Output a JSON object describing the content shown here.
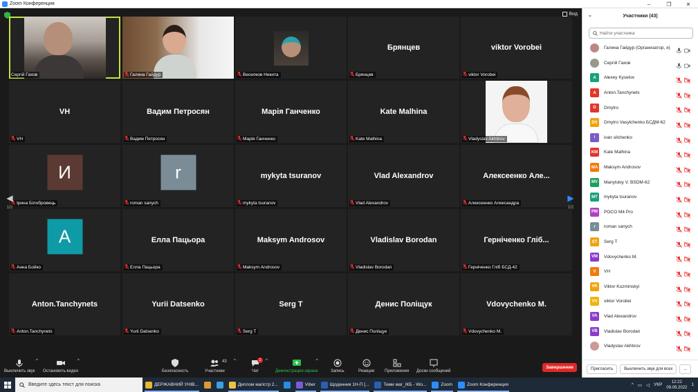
{
  "window": {
    "title": "Zoom Конференция",
    "controls": [
      "–",
      "❐",
      "✕"
    ]
  },
  "meeting": {
    "view_label": "Вид",
    "active_color": "#c5e543",
    "page_left": "1/2",
    "page_right": "1/2",
    "tiles": [
      {
        "name": "Сергій Гахов",
        "type": "video",
        "active": true
      },
      {
        "name": "Галина Гайдур",
        "type": "video"
      },
      {
        "name": "Веселков Никита",
        "type": "video"
      },
      {
        "big": "Брянцев",
        "name": "Брянцев"
      },
      {
        "big": "viktor Vorobei",
        "name": "viktor Vorobei"
      },
      {
        "big": "VH",
        "name": "VH"
      },
      {
        "big": "Вадим Петросян",
        "name": "Вадим Петросян"
      },
      {
        "big": "Марія Ганченко",
        "name": "Марія Ганченко"
      },
      {
        "big": "Kate Malhina",
        "name": "Kate Malhina"
      },
      {
        "name": "Vladyslav Akhtirov",
        "type": "photo"
      },
      {
        "avatar": "И",
        "avatar_color": "#5a3a32",
        "name": "Ірина Білобровець"
      },
      {
        "avatar": "r",
        "avatar_color": "#7a8d96",
        "name": "roman sanych"
      },
      {
        "big": "mykyta tsuranov",
        "name": "mykyta tsuranov"
      },
      {
        "big": "Vlad Alexandrov",
        "name": "Vlad Alexandrov"
      },
      {
        "big": "Алексеенко Але...",
        "name": "Алексеенко Александра"
      },
      {
        "avatar": "A",
        "avatar_color": "#0f9aa8",
        "name": "Анна Бойко"
      },
      {
        "big": "Елла Пацьора",
        "name": "Елла Пацьора"
      },
      {
        "big": "Maksym Androsov",
        "name": "Maksym Androsov"
      },
      {
        "big": "Vladislav Borodan",
        "name": "Vladislav Borodan"
      },
      {
        "big": "Герніченко Гліб...",
        "name": "Герніченко Гліб БСД-42"
      },
      {
        "big": "Anton.Tanchynets",
        "name": "Anton.Tanchynets"
      },
      {
        "big": "Yurii Datsenko",
        "name": "Yurii Datsenko"
      },
      {
        "big": "Serg T",
        "name": "Serg T"
      },
      {
        "big": "Денис Поліщук",
        "name": "Денис Поліщук"
      },
      {
        "big": "Vdovychenko M.",
        "name": "Vdovychenko M."
      }
    ]
  },
  "toolbar": {
    "mute": "Выключить звук",
    "stop_video": "Остановить видео",
    "security": "Безопасность",
    "participants": "Участники",
    "participants_count": "43",
    "chat": "Чат",
    "chat_badge": "1",
    "share": "Демонстрация экрана",
    "record": "Запись",
    "reactions": "Реакции",
    "apps": "Приложения",
    "whiteboards": "Доски сообщений",
    "end": "Завершение"
  },
  "panel": {
    "title": "Участники (43)",
    "search_placeholder": "Найти участника",
    "participants": [
      {
        "name": "Галина Гайдур (Организатор, я)",
        "initials": "",
        "color": "#b88",
        "photo": true,
        "muted": false
      },
      {
        "name": "Сергій Гахов",
        "initials": "",
        "color": "#998",
        "photo": true,
        "muted": false
      },
      {
        "name": "Alexey Kyselov",
        "initials": "A",
        "color": "#1aa07a"
      },
      {
        "name": "Anton.Tanchynets",
        "initials": "A",
        "color": "#e0362c"
      },
      {
        "name": "Dmytro",
        "initials": "D",
        "color": "#e0362c"
      },
      {
        "name": "Dmytro Vasylchenko БСДМ-62",
        "initials": "DV",
        "color": "#f0a20c"
      },
      {
        "name": "ivan silchenko",
        "initials": "i",
        "color": "#7a5cc8"
      },
      {
        "name": "Kate Malhina",
        "initials": "KM",
        "color": "#e0362c"
      },
      {
        "name": "Maksym Androsov",
        "initials": "MA",
        "color": "#f07a0c"
      },
      {
        "name": "Manytskiy V. BSDM-62",
        "initials": "MV",
        "color": "#1aa05a"
      },
      {
        "name": "mykyta tsuranov",
        "initials": "MT",
        "color": "#1aa07a"
      },
      {
        "name": "POCO M4 Pro",
        "initials": "PM",
        "color": "#b040c0"
      },
      {
        "name": "roman sanych",
        "initials": "r",
        "color": "#7a8d96"
      },
      {
        "name": "Serg T",
        "initials": "ST",
        "color": "#f0a20c"
      },
      {
        "name": "Vdovychenko M.",
        "initials": "VM",
        "color": "#8a3cc8"
      },
      {
        "name": "VH",
        "initials": "V",
        "color": "#f07a0c"
      },
      {
        "name": "Viktor Kuzminskyi",
        "initials": "VK",
        "color": "#f0a20c"
      },
      {
        "name": "viktor Vorobei",
        "initials": "VV",
        "color": "#f0b40c"
      },
      {
        "name": "Vlad Alexandrov",
        "initials": "VA",
        "color": "#8a3cc8"
      },
      {
        "name": "Vladislav Borodan",
        "initials": "VB",
        "color": "#8a3cc8"
      },
      {
        "name": "Vladyslav Akhtirov",
        "initials": "",
        "color": "#c99",
        "photo": true
      }
    ],
    "invite": "Пригласить",
    "mute_all": "Выключить звук для всех",
    "more": "..."
  },
  "taskbar": {
    "search_placeholder": "Введите здесь текст для поиска",
    "apps": [
      {
        "label": "ДЕРЖАВНИЙ УНІВ...",
        "color": "#e8b830"
      },
      {
        "label": "",
        "color": "#d93"
      },
      {
        "label": "",
        "color": "#3aa0e0"
      },
      {
        "label": "Диплом магістр 2...",
        "color": "#f0c040"
      },
      {
        "label": "",
        "color": "#2a8ce0"
      },
      {
        "label": "Viber",
        "color": "#7b5cd0"
      },
      {
        "label": "Щоденник 1Н-П [...",
        "color": "#2b5fb0"
      },
      {
        "label": "Теми маг_ІКБ - Wo...",
        "color": "#2b5fb0"
      },
      {
        "label": "Zoom",
        "color": "#2d8cff"
      },
      {
        "label": "Zoom Конференция",
        "color": "#2d8cff"
      }
    ],
    "lang": "УКР",
    "time": "12:22",
    "date": "09.09.2022",
    "notif": "1"
  }
}
